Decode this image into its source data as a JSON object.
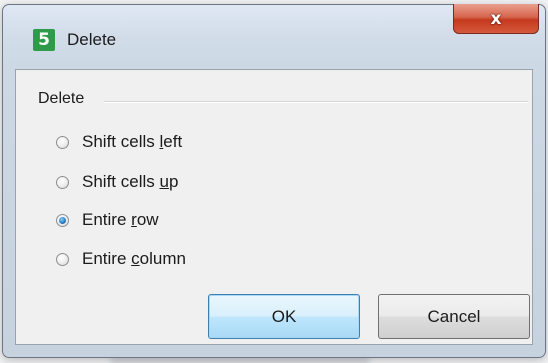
{
  "dialog": {
    "title": "Delete",
    "app_icon_glyph": "5",
    "close_glyph": "x"
  },
  "group": {
    "label": "Delete"
  },
  "options": [
    {
      "pre": "Shift cells ",
      "accel": "l",
      "post": "eft",
      "checked": false
    },
    {
      "pre": "Shift cells ",
      "accel": "u",
      "post": "p",
      "checked": false
    },
    {
      "pre": "Entire ",
      "accel": "r",
      "post": "ow",
      "checked": true
    },
    {
      "pre": "Entire ",
      "accel": "c",
      "post": "olumn",
      "checked": false
    }
  ],
  "buttons": {
    "ok_label": "OK",
    "cancel_label": "Cancel"
  },
  "colors": {
    "app_icon": "#2f9a4a",
    "close_button": "#c4391e",
    "default_button_border": "#3c7fb1"
  }
}
